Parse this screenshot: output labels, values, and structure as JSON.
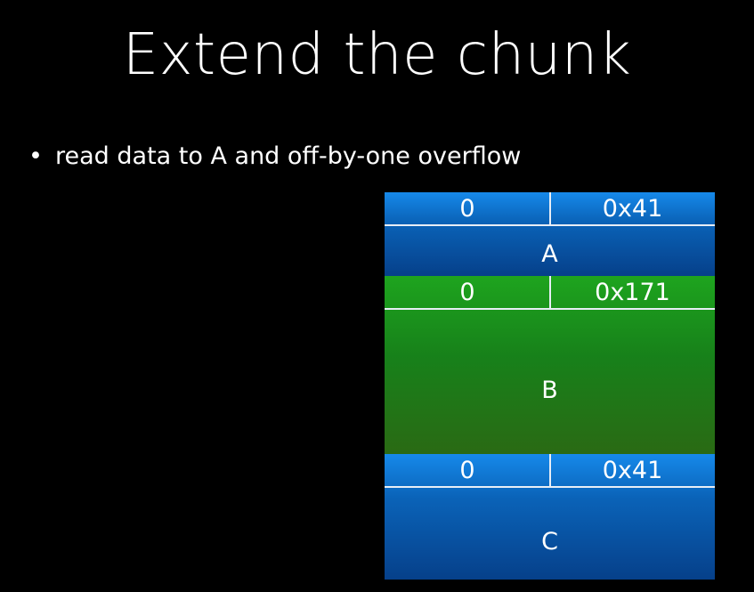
{
  "slide": {
    "title": "Extend the chunk",
    "bullet_symbol": "•",
    "bullet_text": "read data to A and off-by-one overflow"
  },
  "colors": {
    "background": "#000000",
    "chunk_blue": "#0a63b8",
    "chunk_green": "#17811a",
    "text": "#ffffff"
  },
  "chunks": [
    {
      "prev_size": "0",
      "size": "0x41",
      "label": "A"
    },
    {
      "prev_size": "0",
      "size": "0x171",
      "label": "B"
    },
    {
      "prev_size": "0",
      "size": "0x41",
      "label": "C"
    }
  ]
}
